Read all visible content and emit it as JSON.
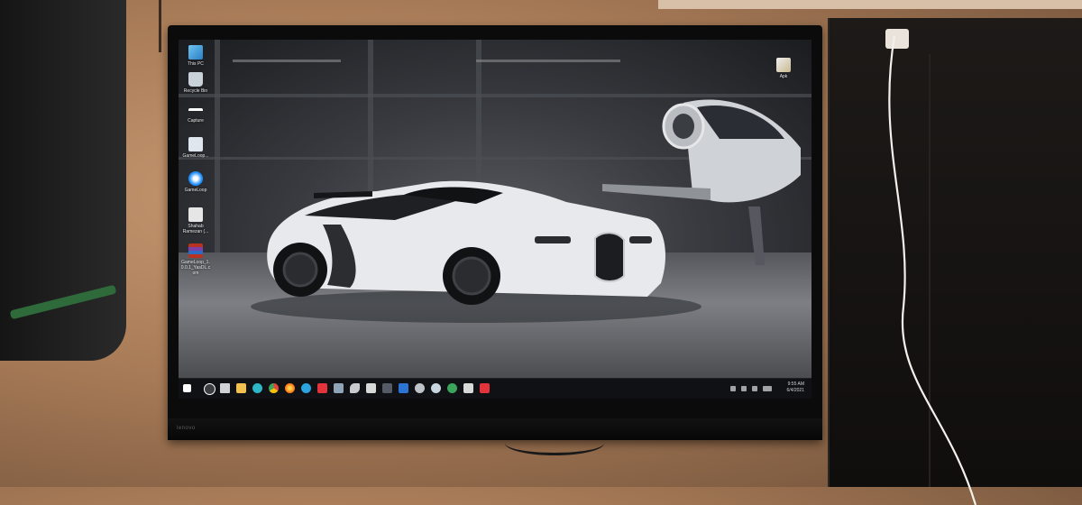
{
  "desktop": {
    "icons": [
      {
        "label": "This PC",
        "icon": "computer-icon",
        "color": "#4aa3df"
      },
      {
        "label": "Recycle Bin",
        "icon": "recycle-bin-icon",
        "color": "#c9d1d9"
      },
      {
        "label": "Capture",
        "icon": "capture-icon",
        "color": "#ffffff"
      },
      {
        "label": "GameLoop...",
        "icon": "file-icon",
        "color": "#dfe6ee"
      },
      {
        "label": "GameLoop",
        "icon": "gameloop-icon",
        "color": "#1e8fff"
      },
      {
        "label": "Shahab Ramezan (...",
        "icon": "audio-file-icon",
        "color": "#e6e6e6"
      },
      {
        "label": "GameLoop_1.0.0.1_YasDL.com",
        "icon": "winrar-archive-icon",
        "color": "#b8321f"
      }
    ],
    "right_icons": [
      {
        "label": "Apk",
        "icon": "apk-icon",
        "color": "#d9d2c0"
      }
    ]
  },
  "taskbar": {
    "items": [
      {
        "name": "start",
        "icon": "windows-start-icon",
        "color": "#ffffff"
      },
      {
        "name": "search",
        "icon": "search-icon",
        "color": "#ffffff"
      },
      {
        "name": "task-view",
        "icon": "task-view-icon",
        "color": "#cfd2d6"
      },
      {
        "name": "file-explorer",
        "icon": "folder-icon",
        "color": "#f2c14e"
      },
      {
        "name": "edge",
        "icon": "edge-icon",
        "color": "#2db6c8"
      },
      {
        "name": "chrome",
        "icon": "chrome-icon",
        "color": "#e2453a"
      },
      {
        "name": "firefox",
        "icon": "firefox-icon",
        "color": "#ff7a1a"
      },
      {
        "name": "telegram",
        "icon": "telegram-icon",
        "color": "#2aa3de"
      },
      {
        "name": "media",
        "icon": "media-player-icon",
        "color": "#e3343c"
      },
      {
        "name": "app",
        "icon": "app-icon",
        "color": "#8fa4b8"
      },
      {
        "name": "bird",
        "icon": "bird-icon",
        "color": "#c7cbd0"
      },
      {
        "name": "app2",
        "icon": "app-icon",
        "color": "#d8d8d8"
      },
      {
        "name": "app3",
        "icon": "app-icon",
        "color": "#555b66"
      },
      {
        "name": "photoshop",
        "icon": "photoshop-icon",
        "color": "#2b74d4"
      },
      {
        "name": "settings",
        "icon": "gear-icon",
        "color": "#bfc4ca"
      },
      {
        "name": "steam",
        "icon": "steam-icon",
        "color": "#c7d5e0"
      },
      {
        "name": "app4",
        "icon": "app-icon",
        "color": "#3ba55d"
      },
      {
        "name": "app5",
        "icon": "app-icon",
        "color": "#d8d8d8"
      },
      {
        "name": "app6",
        "icon": "app-icon",
        "color": "#e3343c"
      }
    ],
    "tray": {
      "clock_time": "9:55 AM",
      "clock_date": "6/4/2021"
    }
  },
  "monitor": {
    "brand": "lenovo"
  }
}
